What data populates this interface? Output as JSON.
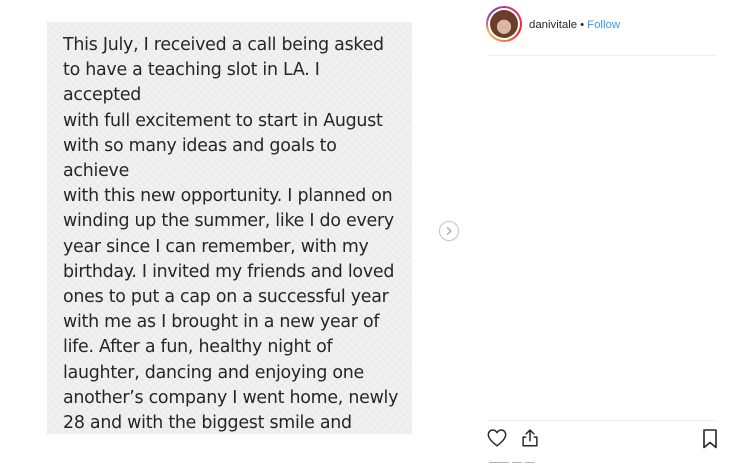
{
  "post": {
    "image_text": "This July, I received a call being asked\nto have a teaching slot in LA. I accepted\nwith full excitement to start in August\nwith so many ideas and goals to achieve\nwith this new opportunity. I planned on\nwinding up the summer, like I do every\nyear since I can remember, with my\nbirthday. I invited my friends and loved\nones to put a cap on a successful year\nwith me as I brought in a new year of\nlife. After a fun, healthy night of\nlaughter, dancing and enjoying one\nanother’s company I went home, newly\n28 and with the biggest smile and\nmemories anyone could ever ask for."
  },
  "header": {
    "username": "danivitale",
    "separator": "•",
    "follow_label": "Follow"
  },
  "icons": {
    "next": "chevron-right-icon",
    "like": "heart-icon",
    "share": "share-icon",
    "save": "bookmark-icon"
  },
  "colors": {
    "follow": "#3897f0",
    "text": "#262626",
    "media_background": "#f1f1f1",
    "divider": "#efefef"
  }
}
